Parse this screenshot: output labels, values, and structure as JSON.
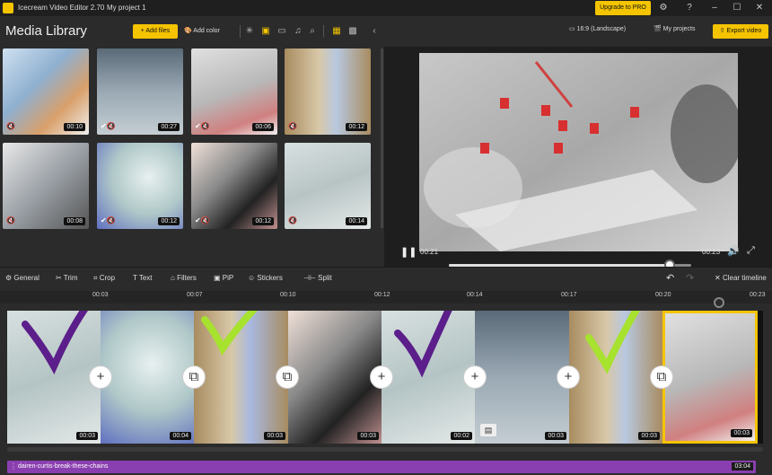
{
  "window": {
    "title": "Icecream Video Editor 2.70",
    "project": "My project 1",
    "upgrade_label": "Upgrade to PRO"
  },
  "library": {
    "title": "Media Library",
    "add_files": "Add files",
    "add_color": "Add color",
    "items": [
      {
        "duration": "00:10",
        "icons": "🔇"
      },
      {
        "duration": "00:27",
        "icons": "✔🔇"
      },
      {
        "duration": "00:06",
        "icons": "✔🔇"
      },
      {
        "duration": "00:12",
        "icons": "🔇"
      },
      {
        "duration": "00:08",
        "icons": "🔇"
      },
      {
        "duration": "00:12",
        "icons": "✔🔇"
      },
      {
        "duration": "00:12",
        "icons": "✔🔇"
      },
      {
        "duration": "00:14",
        "icons": "🔇"
      }
    ]
  },
  "preview": {
    "aspect": "16:9 (Landscape)",
    "my_projects": "My projects",
    "export": "Export video",
    "current_time": "00:21",
    "total_time": "00:23",
    "progress": 0.91
  },
  "toolbar": {
    "general": "General",
    "trim": "Trim",
    "crop": "Crop",
    "text": "Text",
    "filters": "Filters",
    "pip": "PiP",
    "stickers": "Stickers",
    "split": "Split",
    "clear": "Clear timeline"
  },
  "ruler": [
    "00:03",
    "00:07",
    "00:10",
    "00:14",
    "00:17",
    "00:20",
    "00:23"
  ],
  "ruler_extra": [
    "00:12"
  ],
  "timeline": {
    "clips": [
      {
        "duration": "00:03"
      },
      {
        "duration": "00:04"
      },
      {
        "duration": "00:03"
      },
      {
        "duration": "00:03"
      },
      {
        "duration": "00:02"
      },
      {
        "duration": "00:03"
      },
      {
        "duration": "00:03"
      }
    ]
  },
  "audio": {
    "name": "dairen-curtis-break-these-chains",
    "duration": "03:04"
  },
  "colors": {
    "accent": "#f5c400",
    "audio": "#8a3fb0",
    "check_purple": "#5b1e8a",
    "check_green": "#a6e22e"
  }
}
